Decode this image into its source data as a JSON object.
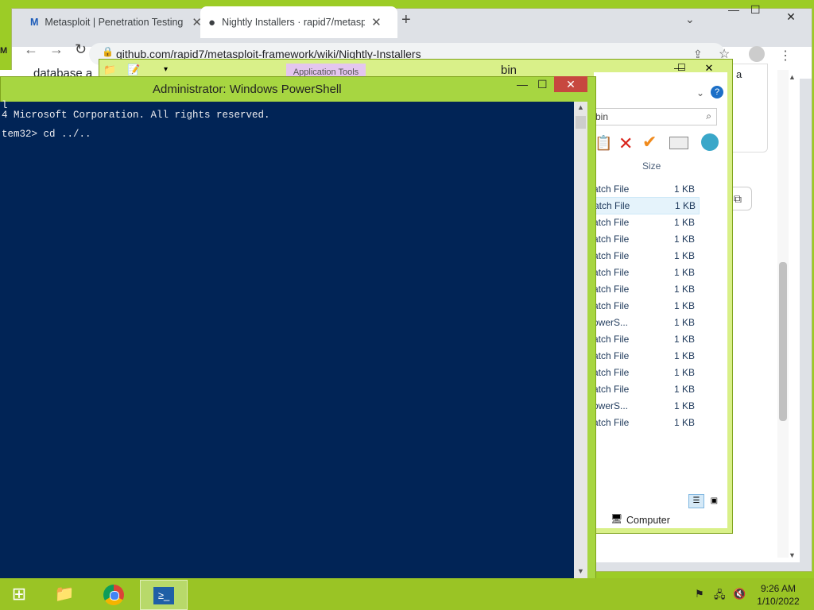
{
  "chrome": {
    "tabs": [
      {
        "title": "Metasploit | Penetration Testing S",
        "icon": "metasploit-icon"
      },
      {
        "title": "Nightly Installers · rapid7/metasp",
        "icon": "github-icon"
      }
    ],
    "new_tab": "+",
    "url": "github.com/rapid7/metasploit-framework/wiki/Nightly-Installers",
    "page_fragment": "database a",
    "page_fragment_right": "a"
  },
  "explorer": {
    "ribbon_context": "Application Tools",
    "title": "bin",
    "search_query": "bin",
    "size_header": "Size",
    "rows": [
      {
        "type": "atch File",
        "size": "1 KB"
      },
      {
        "type": "atch File",
        "size": "1 KB"
      },
      {
        "type": "atch File",
        "size": "1 KB"
      },
      {
        "type": "atch File",
        "size": "1 KB"
      },
      {
        "type": "atch File",
        "size": "1 KB"
      },
      {
        "type": "atch File",
        "size": "1 KB"
      },
      {
        "type": "atch File",
        "size": "1 KB"
      },
      {
        "type": "atch File",
        "size": "1 KB"
      },
      {
        "type": "owerS...",
        "size": "1 KB"
      },
      {
        "type": "atch File",
        "size": "1 KB"
      },
      {
        "type": "atch File",
        "size": "1 KB"
      },
      {
        "type": "atch File",
        "size": "1 KB"
      },
      {
        "type": "atch File",
        "size": "1 KB"
      },
      {
        "type": "owerS...",
        "size": "1 KB"
      },
      {
        "type": "atch File",
        "size": "1 KB"
      }
    ],
    "status_computer": "Computer"
  },
  "powershell": {
    "title": "Administrator: Windows PowerShell",
    "lines": [
      "l",
      "4 Microsoft Corporation. All rights reserved.",
      "",
      "tem32> cd ../.."
    ]
  },
  "taskbar": {
    "time": "9:26 AM",
    "date": "1/10/2022"
  }
}
